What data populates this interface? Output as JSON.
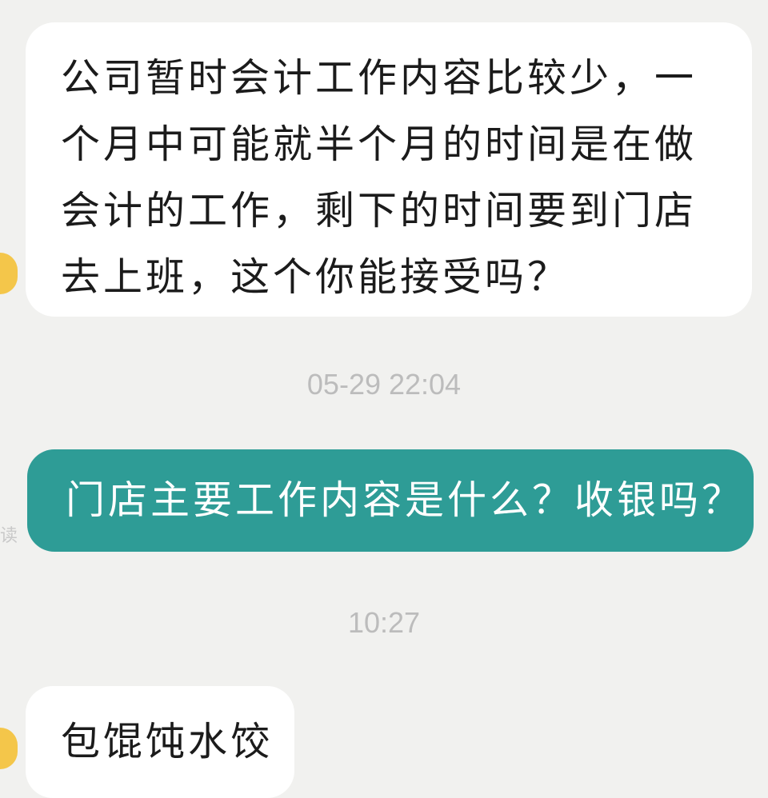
{
  "conversation": {
    "messages": [
      {
        "sender": "other",
        "text": "公司暂时会计工作内容比较少，一个月中可能就半个月的时间是在做会计的工作，剩下的时间要到门店去上班，这个你能接受吗？"
      },
      {
        "sender": "self",
        "text": "门店主要工作内容是什么？收银吗？"
      },
      {
        "sender": "other",
        "text": "包馄饨水饺"
      }
    ],
    "timestamps": [
      "05-29 22:04",
      "10:27"
    ],
    "side_mark": "读"
  },
  "colors": {
    "background": "#f1f1ef",
    "incoming_bubble": "#ffffff",
    "outgoing_bubble": "#2e9c96",
    "timestamp_text": "#bcbcbc",
    "avatar": "#f4c64a"
  }
}
